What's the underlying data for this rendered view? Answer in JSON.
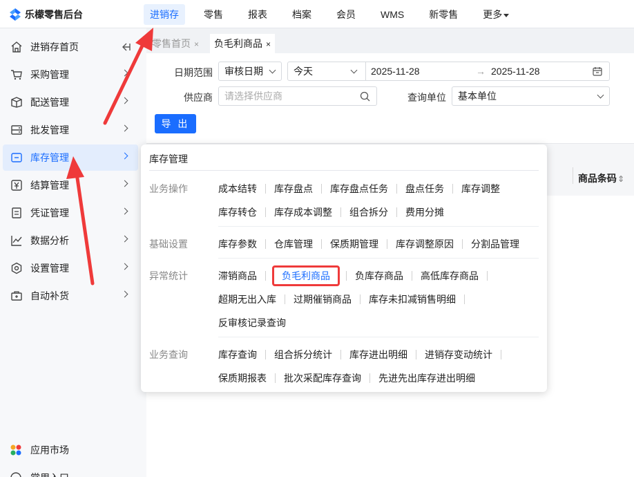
{
  "app": {
    "brand": "乐檬零售后台"
  },
  "topnav": [
    "进销存",
    "零售",
    "报表",
    "档案",
    "会员",
    "WMS",
    "新零售",
    "更多"
  ],
  "sidebar": {
    "items": [
      {
        "label": "进销存首页",
        "icon": "home-icon"
      },
      {
        "label": "采购管理",
        "icon": "cart-icon"
      },
      {
        "label": "配送管理",
        "icon": "box-icon"
      },
      {
        "label": "批发管理",
        "icon": "wholesale-icon"
      },
      {
        "label": "库存管理",
        "icon": "inventory-icon"
      },
      {
        "label": "结算管理",
        "icon": "currency-icon"
      },
      {
        "label": "凭证管理",
        "icon": "document-icon"
      },
      {
        "label": "数据分析",
        "icon": "chart-icon"
      },
      {
        "label": "设置管理",
        "icon": "settings-icon"
      },
      {
        "label": "自动补货",
        "icon": "replenish-icon"
      }
    ],
    "bottom": [
      {
        "label": "应用市场",
        "icon": "app-market-icon"
      },
      {
        "label": "常用入口",
        "icon": "shortcut-icon"
      }
    ]
  },
  "tabs": [
    {
      "label": "零售首页",
      "close": "×"
    },
    {
      "label": "负毛利商品",
      "close": "×"
    }
  ],
  "filters": {
    "date_range_label": "日期范围",
    "date_type": "审核日期",
    "date_preset": "今天",
    "date_start": "2025-11-28",
    "date_arrow": "→",
    "date_end": "2025-11-28",
    "supplier_label": "供应商",
    "supplier_placeholder": "请选择供应商",
    "unit_label": "查询单位",
    "unit_value": "基本单位"
  },
  "toolbar": {
    "export_label": "导 出"
  },
  "grid": {
    "barcode_header": "商品条码",
    "sort_icon": "⇕"
  },
  "popup": {
    "title": "库存管理",
    "groups": {
      "business_ops": {
        "title": "业务操作",
        "row1": [
          "成本结转",
          "库存盘点",
          "库存盘点任务",
          "盘点任务",
          "库存调整"
        ],
        "row2": [
          "库存转仓",
          "库存成本调整",
          "组合拆分",
          "费用分摊"
        ]
      },
      "basic": {
        "title": "基础设置",
        "row1": [
          "库存参数",
          "仓库管理",
          "保质期管理",
          "库存调整原因",
          "分割品管理"
        ]
      },
      "anomaly": {
        "title": "异常统计",
        "row1": [
          "滞销商品",
          "负毛利商品",
          "负库存商品",
          "高低库存商品"
        ],
        "row2": [
          "超期无出入库",
          "过期催销商品",
          "库存未扣减销售明细"
        ],
        "row3": [
          "反审核记录查询"
        ]
      },
      "query": {
        "title": "业务查询",
        "row1": [
          "库存查询",
          "组合拆分统计",
          "库存进出明细",
          "进销存变动统计"
        ],
        "row2": [
          "保质期报表",
          "批次采配库存查询",
          "先进先出库存进出明细"
        ]
      }
    }
  },
  "colors": {
    "accent": "#1a6dff",
    "highlight": "#ef3a3a"
  }
}
